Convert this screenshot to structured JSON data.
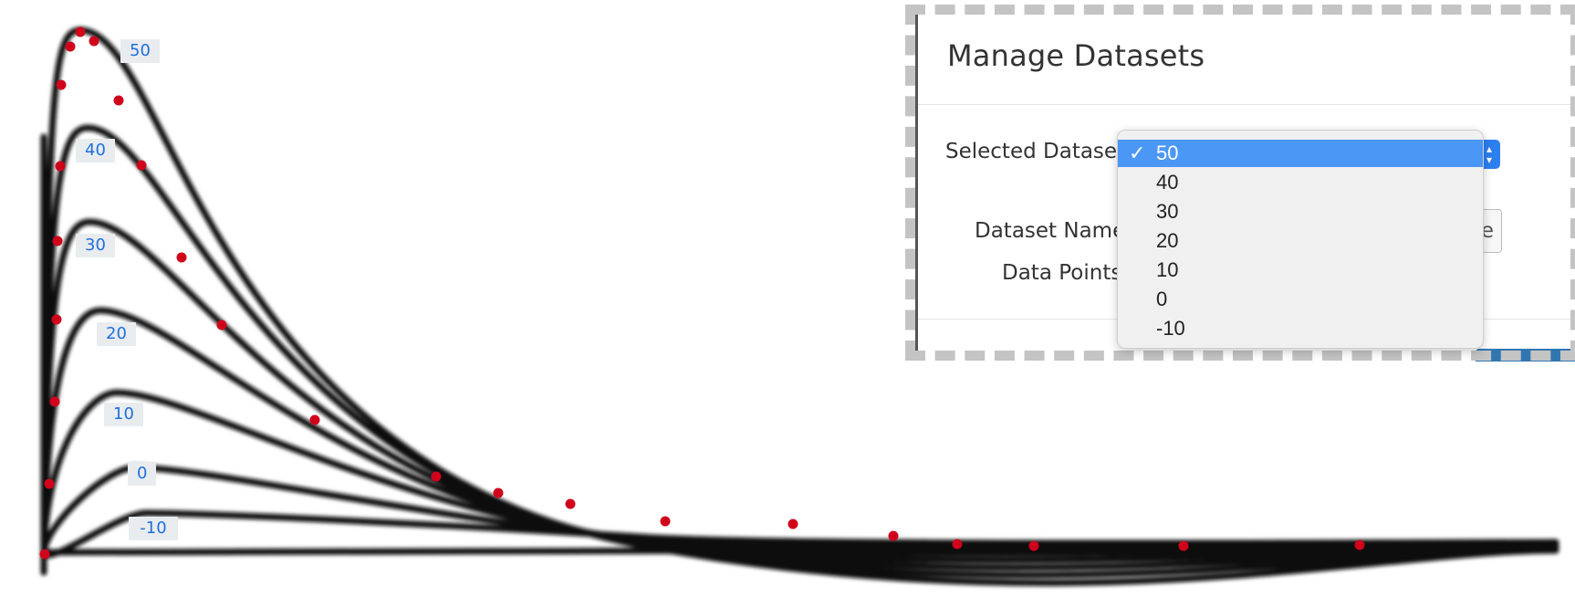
{
  "chart_data": {
    "type": "line",
    "curve_labels": [
      "50",
      "40",
      "30",
      "20",
      "10",
      "0",
      "-10"
    ],
    "red_points_visible": true
  },
  "modal": {
    "title": "Manage Datasets",
    "selected_label": "Selected Datase",
    "name_label": "Dataset Name",
    "points_label": "Data Points",
    "name_value_tail": "e"
  },
  "dropdown": {
    "selected": "50",
    "options": [
      "50",
      "40",
      "30",
      "20",
      "10",
      "0",
      "-10"
    ]
  },
  "icons": {
    "check": "checkmark-icon",
    "select_arrows": "updown-chevron-icon"
  },
  "colors": {
    "accent": "#2d7ff0",
    "highlight": "#4a97f5",
    "point": "#d0021b",
    "label_text": "#1f6fe0"
  }
}
